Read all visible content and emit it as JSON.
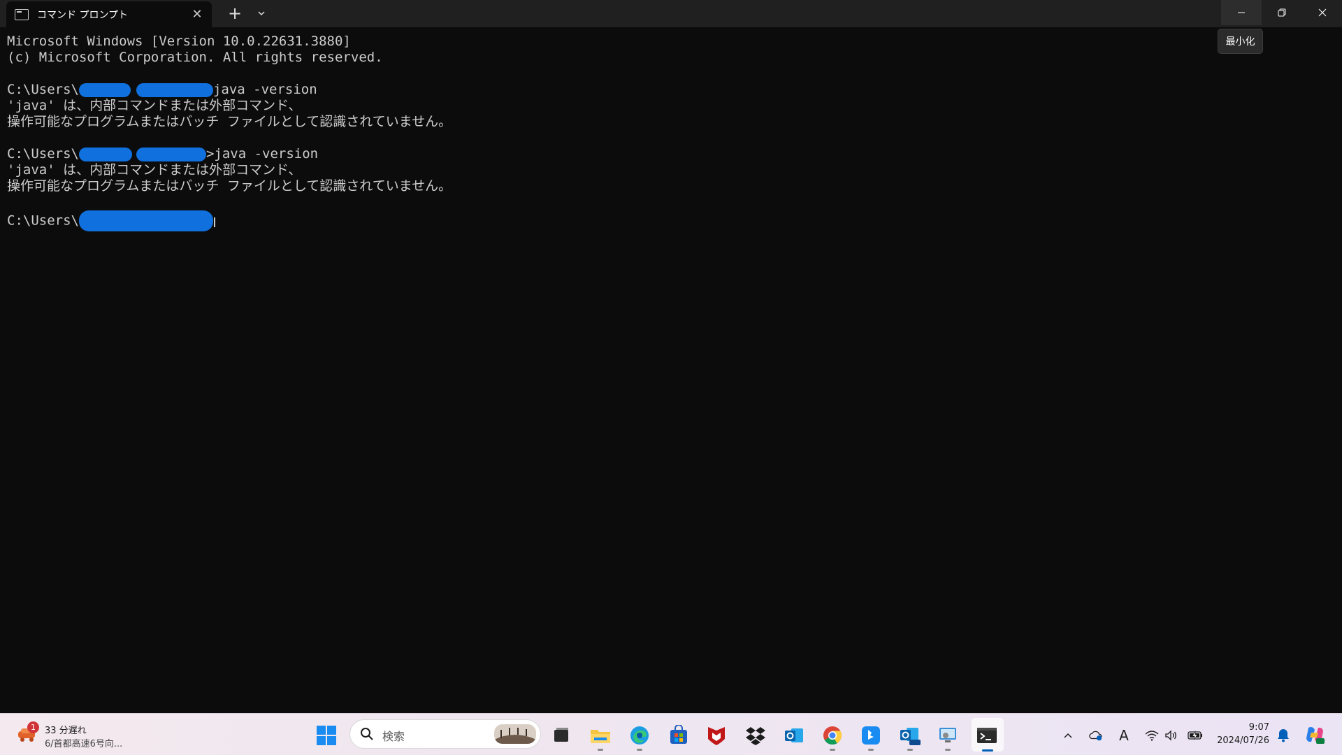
{
  "window": {
    "tab_title": "コマンド プロンプト",
    "tab_close": "✕",
    "new_tab": "+",
    "dropdown": "⌄",
    "tooltip": "最小化",
    "icons": {
      "tab": "console-icon",
      "minimize": "minimize-icon",
      "maximize": "restore-icon",
      "close": "close-icon"
    }
  },
  "console": {
    "banner1": "Microsoft Windows [Version 10.0.22631.3880]",
    "banner2": "(c) Microsoft Corporation. All rights reserved.",
    "prompt_prefix": "C:\\Users\\",
    "cmd1": "java -version",
    "err1a": "'java' は、内部コマンドまたは外部コマンド、",
    "err1b": "操作可能なプログラムまたはバッチ ファイルとして認識されていません。",
    "cmd2": ">java -version",
    "err2a": "'java' は、内部コマンドまたは外部コマンド、",
    "err2b": "操作可能なプログラムまたはバッチ ファイルとして認識されていません。"
  },
  "taskbar": {
    "weather_badge": "1",
    "weather_line1": "33 分遅れ",
    "weather_line2": "6/首都高速6号向...",
    "search_placeholder": "検索",
    "apps": [
      "task-view-icon",
      "file-explorer-icon",
      "edge-icon",
      "store-icon",
      "mcafee-icon",
      "dropbox-icon",
      "outlook-icon",
      "chrome-icon",
      "bing-icon",
      "new-outlook-icon",
      "remote-desktop-icon",
      "terminal-icon"
    ],
    "clock_time": "9:07",
    "clock_date": "2024/07/26",
    "ime_label": "A"
  },
  "colors": {
    "console_bg": "#0c0c0c",
    "console_fg": "#cccccc",
    "redaction": "#1070de",
    "titlebar": "#202020",
    "accent": "#005fb8"
  }
}
